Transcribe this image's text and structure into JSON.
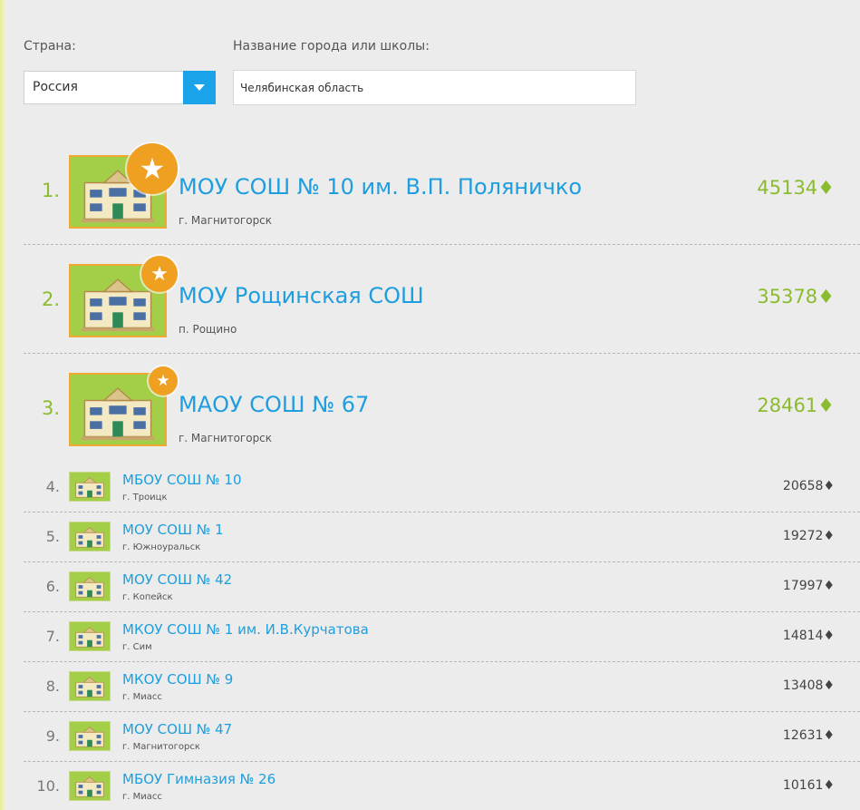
{
  "filters": {
    "country_label": "Страна:",
    "country_value": "Россия",
    "city_label": "Название города или школы:",
    "city_value": "Челябинская область"
  },
  "schools": [
    {
      "rank": "1.",
      "name": "МОУ СОШ № 10 им. В.П. Поляничко",
      "city": "г. Магнитогорск",
      "score": "45134♦"
    },
    {
      "rank": "2.",
      "name": "МОУ Рощинская СОШ",
      "city": "п. Рощино",
      "score": "35378♦"
    },
    {
      "rank": "3.",
      "name": "МАОУ СОШ № 67",
      "city": "г. Магнитогорск",
      "score": "28461♦"
    },
    {
      "rank": "4.",
      "name": "МБОУ СОШ № 10",
      "city": "г. Троицк",
      "score": "20658♦"
    },
    {
      "rank": "5.",
      "name": "МОУ СОШ № 1",
      "city": "г. Южноуральск",
      "score": "19272♦"
    },
    {
      "rank": "6.",
      "name": "МОУ СОШ № 42",
      "city": "г. Копейск",
      "score": "17997♦"
    },
    {
      "rank": "7.",
      "name": "МКОУ СОШ № 1 им. И.В.Курчатова",
      "city": "г. Сим",
      "score": "14814♦"
    },
    {
      "rank": "8.",
      "name": "МКОУ СОШ № 9",
      "city": "г. Миасс",
      "score": "13408♦"
    },
    {
      "rank": "9.",
      "name": "МОУ СОШ № 47",
      "city": "г. Магнитогорск",
      "score": "12631♦"
    },
    {
      "rank": "10.",
      "name": "МБОУ Гимназия № 26",
      "city": "г. Миасс",
      "score": "10161♦"
    }
  ],
  "icons": {
    "school": "school-building-icon",
    "star": "star-icon",
    "dropdown": "chevron-down-icon"
  },
  "colors": {
    "accent_blue": "#1e9ede",
    "rank_green": "#8bbb2e",
    "badge_green": "#a3cf48",
    "star_orange": "#f0a020"
  }
}
